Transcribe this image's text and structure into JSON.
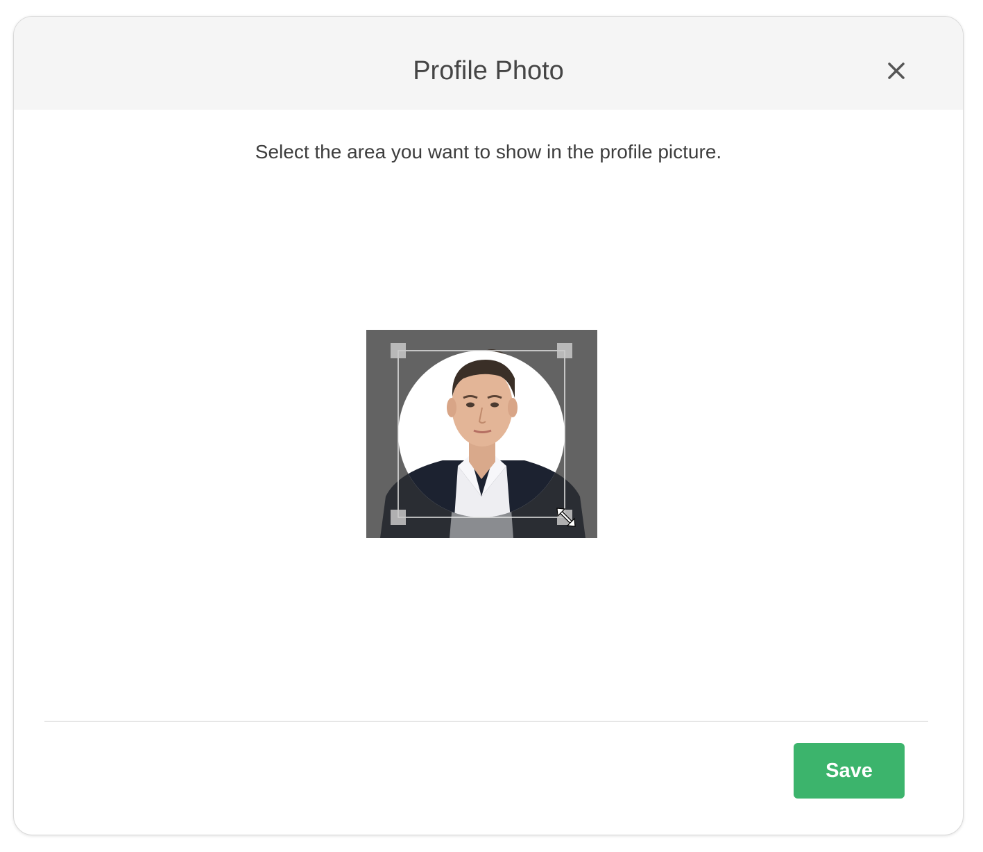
{
  "dialog": {
    "title": "Profile Photo",
    "close_icon": "close-icon",
    "instruction": "Select the area you want to show in the profile picture.",
    "save_label": "Save",
    "accent_color": "#3cb46c"
  },
  "cropper": {
    "shape": "circle",
    "resize_icon": "diagonal-resize-icon",
    "handles": [
      "top-left",
      "top-right",
      "bottom-left",
      "bottom-right"
    ]
  }
}
